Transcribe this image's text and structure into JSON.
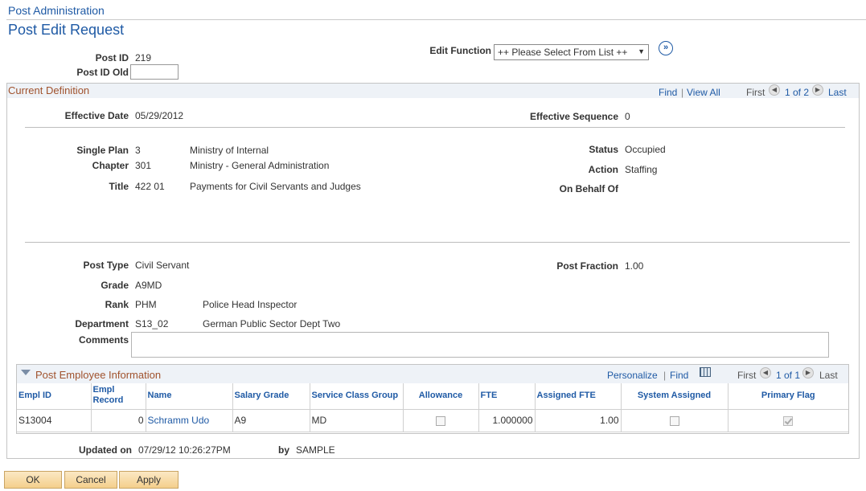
{
  "breadcrumb": "Post Administration",
  "page_title": "Post Edit Request",
  "post_id_label": "Post ID",
  "post_id_value": "219",
  "post_id_old_label": "Post ID Old",
  "post_id_old_value": "",
  "edit_function_label": "Edit Function",
  "edit_function_value": "++ Please Select From List ++",
  "current_definition": {
    "title": "Current Definition",
    "find": "Find",
    "separator": "|",
    "view_all": "View All",
    "first": "First",
    "counter": "1 of 2",
    "last": "Last",
    "effective_date_label": "Effective Date",
    "effective_date": "05/29/2012",
    "effective_sequence_label": "Effective Sequence",
    "effective_sequence": "0",
    "single_plan_label": "Single Plan",
    "single_plan_code": "3",
    "single_plan_desc": "Ministry of Internal",
    "chapter_label": "Chapter",
    "chapter_code": "301",
    "chapter_desc": "Ministry - General Administration",
    "title_label": "Title",
    "title_code": "422 01",
    "title_desc": "Payments for Civil Servants and Judges",
    "status_label": "Status",
    "status_value": "Occupied",
    "action_label": "Action",
    "action_value": "Staffing",
    "on_behalf_label": "On Behalf Of",
    "post_type_label": "Post Type",
    "post_type_value": "Civil Servant",
    "post_fraction_label": "Post Fraction",
    "post_fraction_value": "1.00",
    "grade_label": "Grade",
    "grade_value": "A9MD",
    "rank_label": "Rank",
    "rank_code": "PHM",
    "rank_desc": "Police Head Inspector",
    "department_label": "Department",
    "department_code": "S13_02",
    "department_desc": "German Public Sector Dept Two",
    "comments_label": "Comments",
    "comments_value": ""
  },
  "employee_grid": {
    "title": "Post Employee Information",
    "personalize": "Personalize",
    "separator": "|",
    "find": "Find",
    "first": "First",
    "counter": "1 of 1",
    "last": "Last",
    "columns": [
      "Empl ID",
      "Empl Record",
      "Name",
      "Salary Grade",
      "Service Class Group",
      "Allowance",
      "FTE",
      "Assigned FTE",
      "System Assigned",
      "Primary Flag"
    ],
    "rows": [
      {
        "empl_id": "S13004",
        "empl_record": "0",
        "name": "Schramm Udo",
        "salary_grade": "A9",
        "service_class_group": "MD",
        "allowance": false,
        "fte": "1.000000",
        "assigned_fte": "1.00",
        "system_assigned": false,
        "primary_flag": true
      }
    ]
  },
  "updated_on_label": "Updated on",
  "updated_on_value": "07/29/12 10:26:27PM",
  "by_label": "by",
  "by_value": "SAMPLE",
  "buttons": {
    "ok": "OK",
    "cancel": "Cancel",
    "apply": "Apply"
  },
  "icons": {
    "go": "double-chevron-right-icon",
    "prev": "chevron-left-icon",
    "next": "chevron-right-icon",
    "collapse": "triangle-down-icon",
    "view_grid": "grid-icon"
  }
}
